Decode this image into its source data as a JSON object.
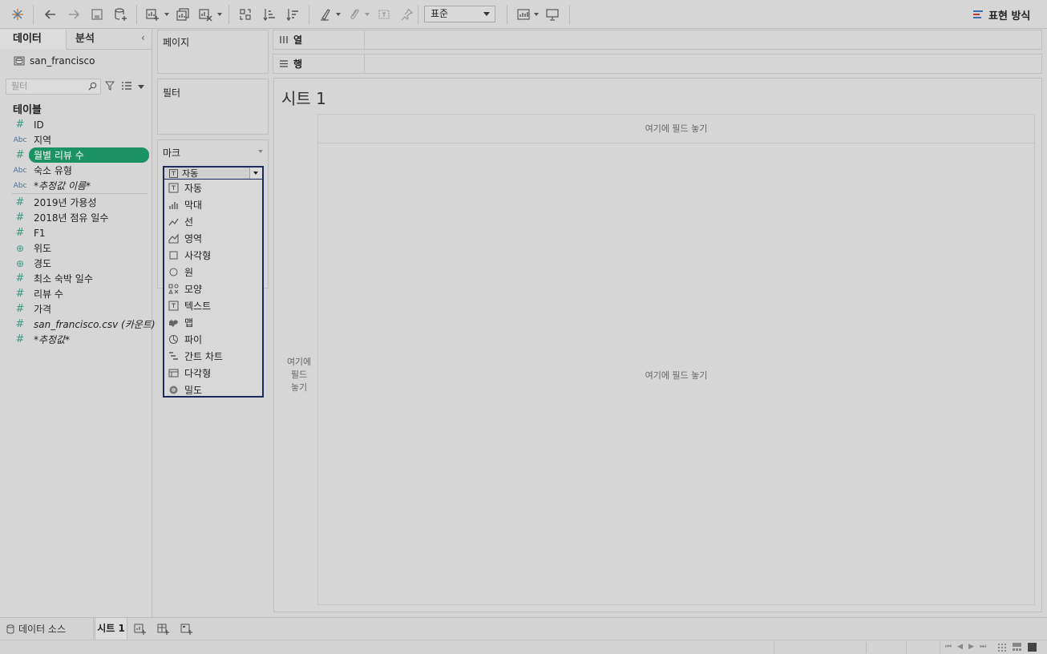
{
  "toolbar": {
    "icons": [
      "tableau-logo-icon",
      "undo-icon",
      "redo-icon",
      "save-icon",
      "new-datasource-icon",
      "new-worksheet-icon",
      "duplicate-sheet-icon",
      "clear-sheet-icon",
      "swap-axes-icon",
      "sort-ascending-icon",
      "sort-descending-icon",
      "highlight-icon",
      "group-icon",
      "labels-icon",
      "pin-icon",
      "chart-size-icon",
      "presentation-icon"
    ],
    "fit_select": "표준",
    "show_me_label": "표현 방식"
  },
  "left_panel": {
    "tab_data": "데이터",
    "tab_analysis": "분석",
    "collapse": "‹",
    "datasource": "san_francisco",
    "filter_placeholder": "필터",
    "tables_heading": "테이블",
    "fields": [
      {
        "type": "#",
        "name": "ID"
      },
      {
        "type": "Abc",
        "name": "지역"
      },
      {
        "type": "#",
        "name": "월별 리뷰 수"
      },
      {
        "type": "Abc",
        "name": "숙소 유형"
      },
      {
        "type": "Abc",
        "name": "*추정값 이름*"
      },
      {
        "type": "#",
        "name": "2019년 가용성"
      },
      {
        "type": "#",
        "name": "2018년 점유 일수"
      },
      {
        "type": "#",
        "name": "F1"
      },
      {
        "type": "geo",
        "name": "위도"
      },
      {
        "type": "geo",
        "name": "경도"
      },
      {
        "type": "#",
        "name": "최소 숙박 일수"
      },
      {
        "type": "#",
        "name": "리뷰 수"
      },
      {
        "type": "#",
        "name": "가격"
      },
      {
        "type": "#",
        "name": "san_francisco.csv (카운트)"
      },
      {
        "type": "#",
        "name": "*추정값*"
      }
    ]
  },
  "shelves": {
    "pages": "페이지",
    "filters": "필터",
    "marks": "마크",
    "columns": "열",
    "rows": "행"
  },
  "marks_dropdown": {
    "selected": "자동",
    "options": [
      "자동",
      "막대",
      "선",
      "영역",
      "사각형",
      "원",
      "모양",
      "텍스트",
      "맵",
      "파이",
      "간트 차트",
      "다각형",
      "밀도"
    ]
  },
  "view": {
    "sheet_title": "시트 1",
    "drop_top": "여기에 필드 놓기",
    "drop_main": "여기에 필드 놓기",
    "drop_left_1": "여기에",
    "drop_left_2": "필드",
    "drop_left_3": "놓기"
  },
  "bottom": {
    "datasource_tab": "데이터 소스",
    "sheet_tab": "시트 1"
  },
  "colors": {
    "selected_field": "#1a9261",
    "dropdown_border": "#1b2a5a",
    "show_me_accent": "#c0392b"
  }
}
